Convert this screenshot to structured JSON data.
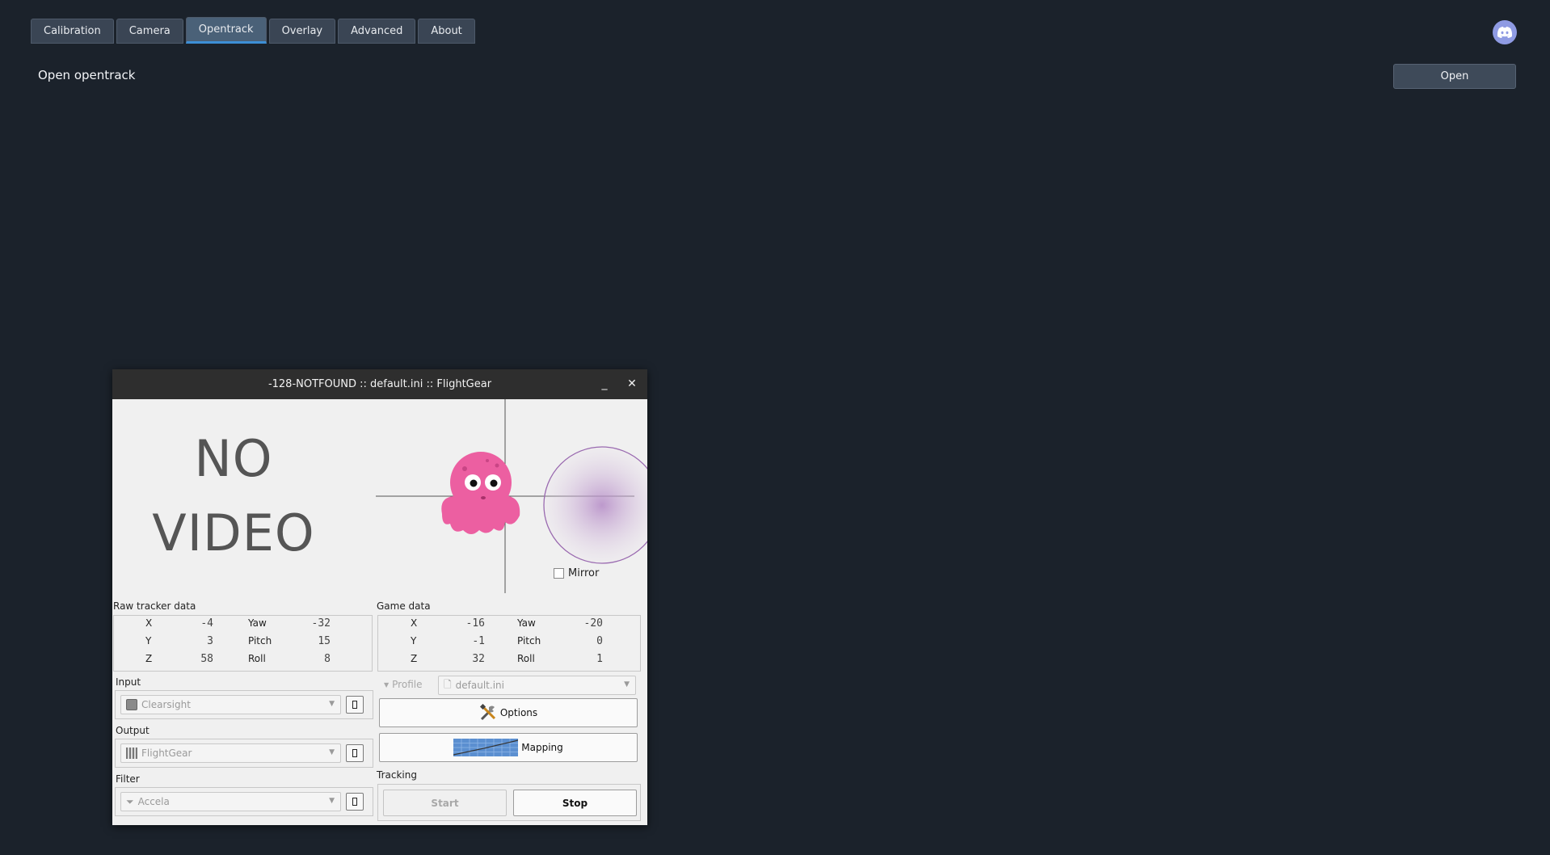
{
  "tabs": [
    {
      "label": "Calibration"
    },
    {
      "label": "Camera"
    },
    {
      "label": "Opentrack",
      "active": true
    },
    {
      "label": "Overlay"
    },
    {
      "label": "Advanced"
    },
    {
      "label": "About"
    }
  ],
  "main": {
    "open_opentrack_label": "Open opentrack",
    "open_button": "Open"
  },
  "window": {
    "title": "-128-NOTFOUND :: default.ini :: FlightGear",
    "minimize": "_",
    "close": "✕",
    "preview": {
      "no_video_line1": "NO",
      "no_video_line2": "VIDEO",
      "mirror_label": "Mirror"
    },
    "raw": {
      "label": "Raw tracker data",
      "x_label": "X",
      "x": "-4",
      "y_label": "Y",
      "y": "3",
      "z_label": "Z",
      "z": "58",
      "yaw_label": "Yaw",
      "yaw": "-32",
      "pitch_label": "Pitch",
      "pitch": "15",
      "roll_label": "Roll",
      "roll": "8"
    },
    "game": {
      "label": "Game data",
      "x_label": "X",
      "x": "-16",
      "y_label": "Y",
      "y": "-1",
      "z_label": "Z",
      "z": "32",
      "yaw_label": "Yaw",
      "yaw": "-20",
      "pitch_label": "Pitch",
      "pitch": "0",
      "roll_label": "Roll",
      "roll": "1"
    },
    "input": {
      "label": "Input",
      "value": "Clearsight"
    },
    "output": {
      "label": "Output",
      "value": "FlightGear"
    },
    "filter": {
      "label": "Filter",
      "value": "Accela"
    },
    "profile": {
      "label": "Profile",
      "value": "default.ini"
    },
    "options_button": "Options",
    "mapping_button": "Mapping",
    "tracking": {
      "label": "Tracking",
      "start": "Start",
      "stop": "Stop"
    }
  },
  "colors": {
    "background": "#1b222b",
    "tab_active_accent": "#3d8fd6",
    "discord": "#8f9be3",
    "octopus": "#ec5fa1",
    "pose_circle": "#9a6ab0"
  },
  "icons": {
    "discord": "discord-icon",
    "octopus": "octopus-icon",
    "options": "tools-icon",
    "mapping": "curve-grid-icon"
  }
}
